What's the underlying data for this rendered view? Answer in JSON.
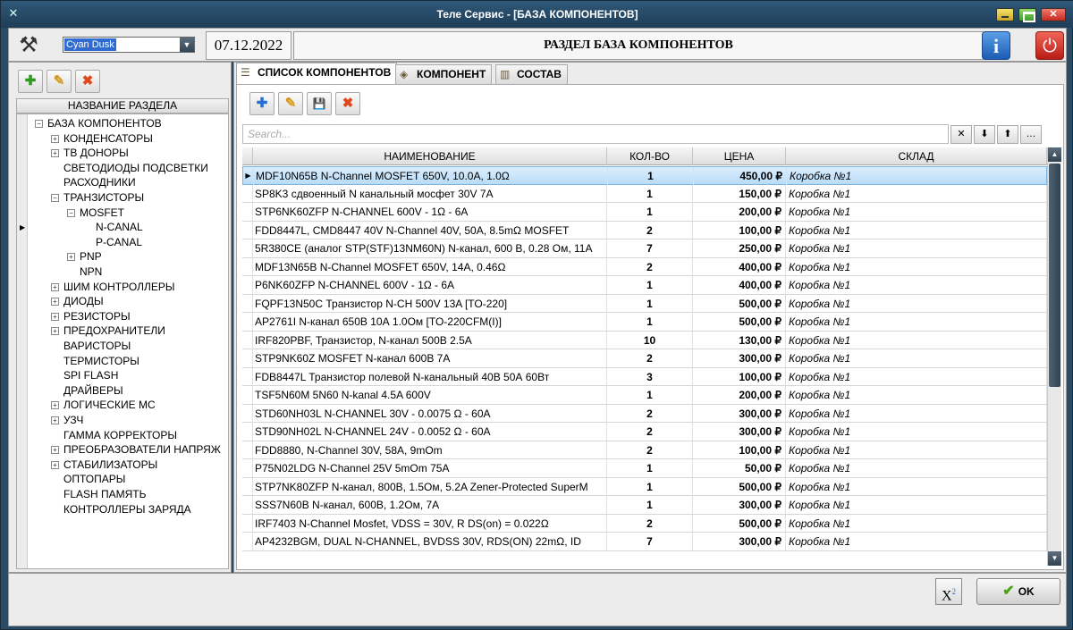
{
  "window": {
    "title": "Теле Сервис - [БАЗА КОМПОНЕНТОВ]"
  },
  "header": {
    "theme_value": "Cyan Dusk",
    "date": "07.12.2022",
    "section_title": "РАЗДЕЛ БАЗА КОМПОНЕНТОВ",
    "info_label": "i",
    "power_label": "⏻"
  },
  "left": {
    "tree_header": "НАЗВАНИЕ РАЗДЕЛА",
    "nodes": [
      {
        "label": "БАЗА КОМПОНЕНТОВ",
        "level": 0,
        "exp": "−"
      },
      {
        "label": "КОНДЕНСАТОРЫ",
        "level": 1,
        "exp": "+"
      },
      {
        "label": "ТВ ДОНОРЫ",
        "level": 1,
        "exp": "+"
      },
      {
        "label": "СВЕТОДИОДЫ ПОДСВЕТКИ",
        "level": 1,
        "exp": ""
      },
      {
        "label": "РАСХОДНИКИ",
        "level": 1,
        "exp": ""
      },
      {
        "label": "ТРАНЗИСТОРЫ",
        "level": 1,
        "exp": "−"
      },
      {
        "label": "MOSFET",
        "level": 2,
        "exp": "−"
      },
      {
        "label": "N-CANAL",
        "level": 3,
        "exp": ""
      },
      {
        "label": "P-CANAL",
        "level": 3,
        "exp": ""
      },
      {
        "label": "PNP",
        "level": 2,
        "exp": "+"
      },
      {
        "label": "NPN",
        "level": 2,
        "exp": ""
      },
      {
        "label": "ШИМ КОНТРОЛЛЕРЫ",
        "level": 1,
        "exp": "+"
      },
      {
        "label": "ДИОДЫ",
        "level": 1,
        "exp": "+"
      },
      {
        "label": "РЕЗИСТОРЫ",
        "level": 1,
        "exp": "+"
      },
      {
        "label": "ПРЕДОХРАНИТЕЛИ",
        "level": 1,
        "exp": "+"
      },
      {
        "label": "ВАРИСТОРЫ",
        "level": 1,
        "exp": ""
      },
      {
        "label": "ТЕРМИСТОРЫ",
        "level": 1,
        "exp": ""
      },
      {
        "label": "SPI FLASH",
        "level": 1,
        "exp": ""
      },
      {
        "label": "ДРАЙВЕРЫ",
        "level": 1,
        "exp": ""
      },
      {
        "label": "ЛОГИЧЕСКИЕ МС",
        "level": 1,
        "exp": "+"
      },
      {
        "label": "УЗЧ",
        "level": 1,
        "exp": "+"
      },
      {
        "label": "ГАММА КОРРЕКТОРЫ",
        "level": 1,
        "exp": ""
      },
      {
        "label": "ПРЕОБРАЗОВАТЕЛИ НАПРЯЖ",
        "level": 1,
        "exp": "+"
      },
      {
        "label": "СТАБИЛИЗАТОРЫ",
        "level": 1,
        "exp": "+"
      },
      {
        "label": "ОПТОПАРЫ",
        "level": 1,
        "exp": ""
      },
      {
        "label": "FLASH ПАМЯТЬ",
        "level": 1,
        "exp": ""
      },
      {
        "label": "КОНТРОЛЛЕРЫ ЗАРЯДА",
        "level": 1,
        "exp": ""
      }
    ]
  },
  "tabs": [
    {
      "label": "СПИСОК КОМПОНЕНТОВ",
      "icon": "list-icon",
      "active": true
    },
    {
      "label": "КОМПОНЕНТ",
      "icon": "chip-icon",
      "active": false
    },
    {
      "label": "СОСТАВ",
      "icon": "composition-icon",
      "active": false
    }
  ],
  "search": {
    "placeholder": "Search..."
  },
  "grid": {
    "columns": [
      "НАИМЕНОВАНИЕ",
      "КОЛ-ВО",
      "ЦЕНА",
      "СКЛАД"
    ],
    "rows": [
      {
        "name": "MDF10N65B N-Channel MOSFET  650V, 10.0A, 1.0Ω",
        "qty": "1",
        "price": "450,00 ₽",
        "store": "Коробка №1"
      },
      {
        "name": "SP8K3 сдвоенный N канальный мосфет 30V 7A",
        "qty": "1",
        "price": "150,00 ₽",
        "store": "Коробка №1"
      },
      {
        "name": "STP6NK60ZFP N-CHANNEL 600V - 1Ω - 6A",
        "qty": "1",
        "price": "200,00 ₽",
        "store": "Коробка №1"
      },
      {
        "name": "FDD8447L, CMD8447 40V N-Channel 40V, 50A, 8.5mΩ MOSFET",
        "qty": "2",
        "price": "100,00 ₽",
        "store": "Коробка №1"
      },
      {
        "name": "5R380CE (аналог STP(STF)13NM60N) N-канал, 600 В, 0.28 Ом, 11А",
        "qty": "7",
        "price": "250,00 ₽",
        "store": "Коробка №1"
      },
      {
        "name": "MDF13N65B N-Channel MOSFET 650V, 14A, 0.46Ω",
        "qty": "2",
        "price": "400,00 ₽",
        "store": "Коробка №1"
      },
      {
        "name": "P6NK60ZFP N-CHANNEL 600V - 1Ω - 6A",
        "qty": "1",
        "price": "400,00 ₽",
        "store": "Коробка №1"
      },
      {
        "name": "FQPF13N50C Транзистор N-CH 500V 13A [TO-220]",
        "qty": "1",
        "price": "500,00 ₽",
        "store": "Коробка №1"
      },
      {
        "name": "AP2761I N-канал 650В 10А 1.0Ом [TO-220CFM(I)]",
        "qty": "1",
        "price": "500,00 ₽",
        "store": "Коробка №1"
      },
      {
        "name": "IRF820PBF, Транзистор, N-канал 500В 2.5А",
        "qty": "10",
        "price": "130,00 ₽",
        "store": "Коробка №1"
      },
      {
        "name": "STP9NK60Z MOSFET N-канал 600В 7А",
        "qty": "2",
        "price": "300,00 ₽",
        "store": "Коробка №1"
      },
      {
        "name": "FDB8447L Транзистор полевой N-канальный 40В 50А 60Вт",
        "qty": "3",
        "price": "100,00 ₽",
        "store": "Коробка №1"
      },
      {
        "name": "TSF5N60M 5N60 N-kanal 4.5A 600V",
        "qty": "1",
        "price": "200,00 ₽",
        "store": "Коробка №1"
      },
      {
        "name": "STD60NH03L N-CHANNEL 30V - 0.0075 Ω - 60A",
        "qty": "2",
        "price": "300,00 ₽",
        "store": "Коробка №1"
      },
      {
        "name": "STD90NH02L N-CHANNEL 24V - 0.0052 Ω - 60A",
        "qty": "2",
        "price": "300,00 ₽",
        "store": "Коробка №1"
      },
      {
        "name": "FDD8880, N-Channel 30V, 58A, 9mOm",
        "qty": "2",
        "price": "100,00 ₽",
        "store": "Коробка №1"
      },
      {
        "name": "P75N02LDG N-Channel 25V 5mOm 75A",
        "qty": "1",
        "price": "50,00 ₽",
        "store": "Коробка №1"
      },
      {
        "name": "STP7NK80ZFP N-канал, 800В, 1.5Ом, 5.2A Zener-Protected SuperM",
        "qty": "1",
        "price": "500,00 ₽",
        "store": "Коробка №1"
      },
      {
        "name": "SSS7N60B N-канал, 600В, 1.2Ом, 7А",
        "qty": "1",
        "price": "300,00 ₽",
        "store": "Коробка №1"
      },
      {
        "name": "IRF7403 N-Channel Mosfet, VDSS = 30V, R DS(on) = 0.022Ω",
        "qty": "2",
        "price": "500,00 ₽",
        "store": "Коробка №1"
      },
      {
        "name": "AP4232BGM, DUAL N-CHANNEL, BVDSS 30V, RDS(ON) 22mΩ, ID",
        "qty": "7",
        "price": "300,00 ₽",
        "store": "Коробка №1"
      }
    ]
  },
  "footer": {
    "formula_label": "X",
    "formula_sup": "2",
    "ok_label": "OK"
  }
}
